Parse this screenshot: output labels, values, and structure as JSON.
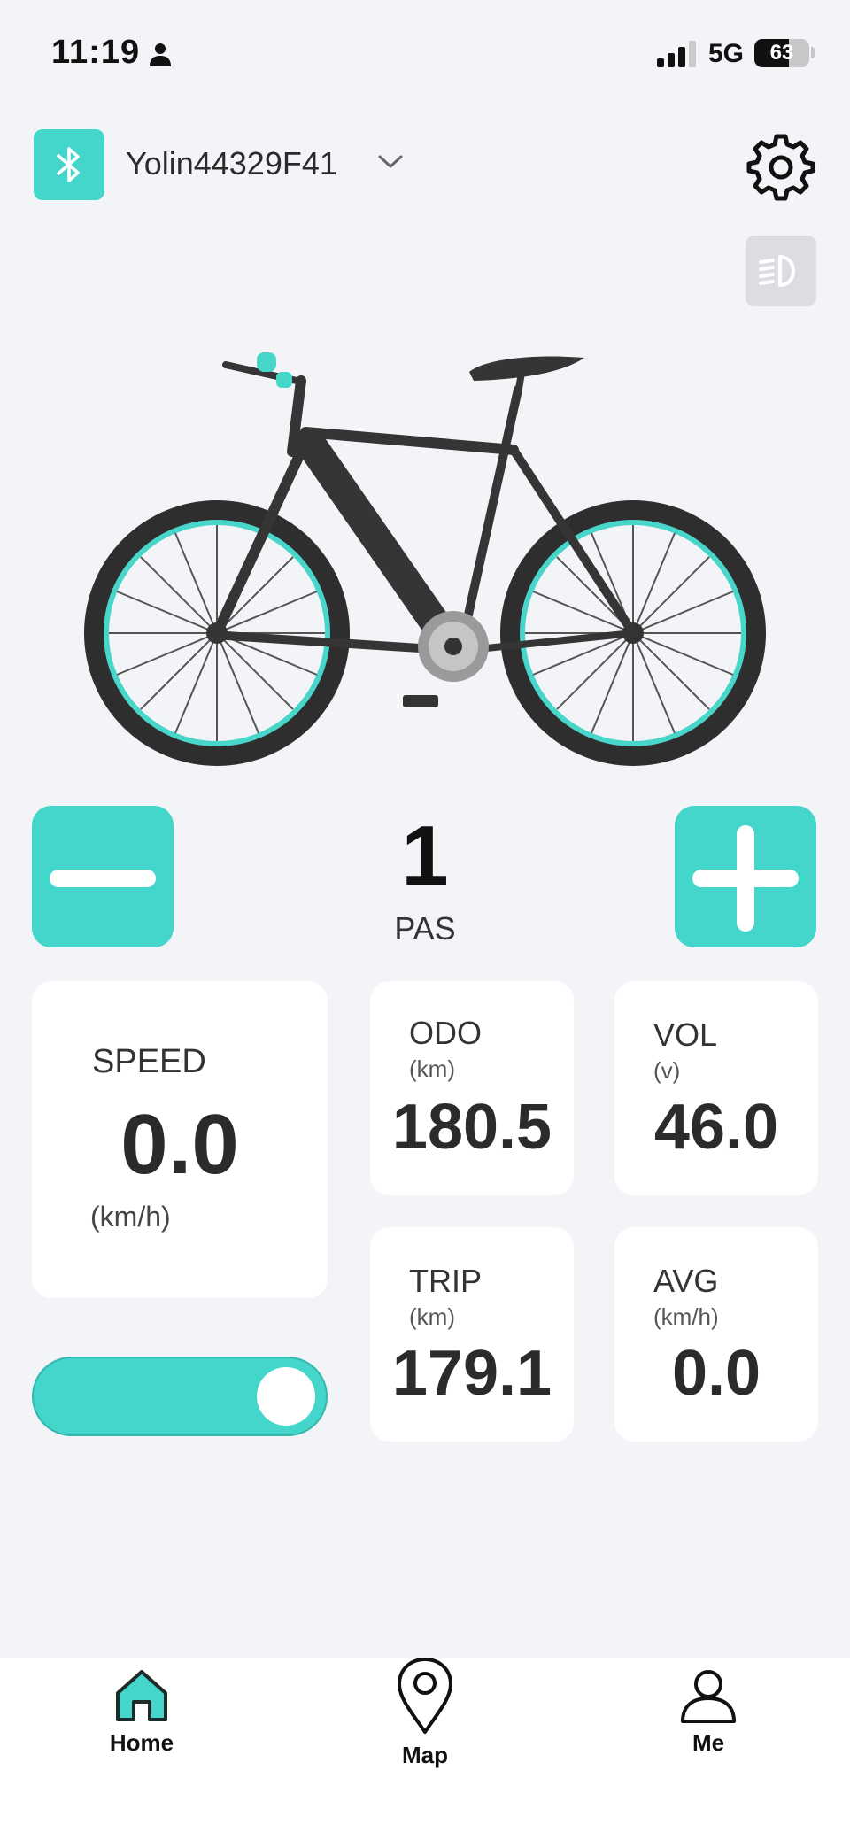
{
  "status_bar": {
    "time": "11:19",
    "network": "5G",
    "battery": "63"
  },
  "header": {
    "device_name": "Yolin44329F41",
    "bluetooth_icon": "bluetooth-icon",
    "settings_icon": "gear-icon",
    "headlight_icon": "headlight-icon"
  },
  "pas": {
    "value": "1",
    "label": "PAS"
  },
  "speed": {
    "label": "SPEED",
    "value": "0.0",
    "unit": "(km/h)"
  },
  "stats": {
    "odo": {
      "label": "ODO",
      "unit": "(km)",
      "value": "180.5"
    },
    "vol": {
      "label": "VOL",
      "unit": "(v)",
      "value": "46.0"
    },
    "trip": {
      "label": "TRIP",
      "unit": "(km)",
      "value": "179.1"
    },
    "avg": {
      "label": "AVG",
      "unit": "(km/h)",
      "value": "0.0"
    }
  },
  "toggle": {
    "state": "on"
  },
  "nav": {
    "home": "Home",
    "map": "Map",
    "me": "Me"
  },
  "colors": {
    "accent": "#45d6cb",
    "background": "#f3f4f8",
    "card": "#ffffff"
  }
}
